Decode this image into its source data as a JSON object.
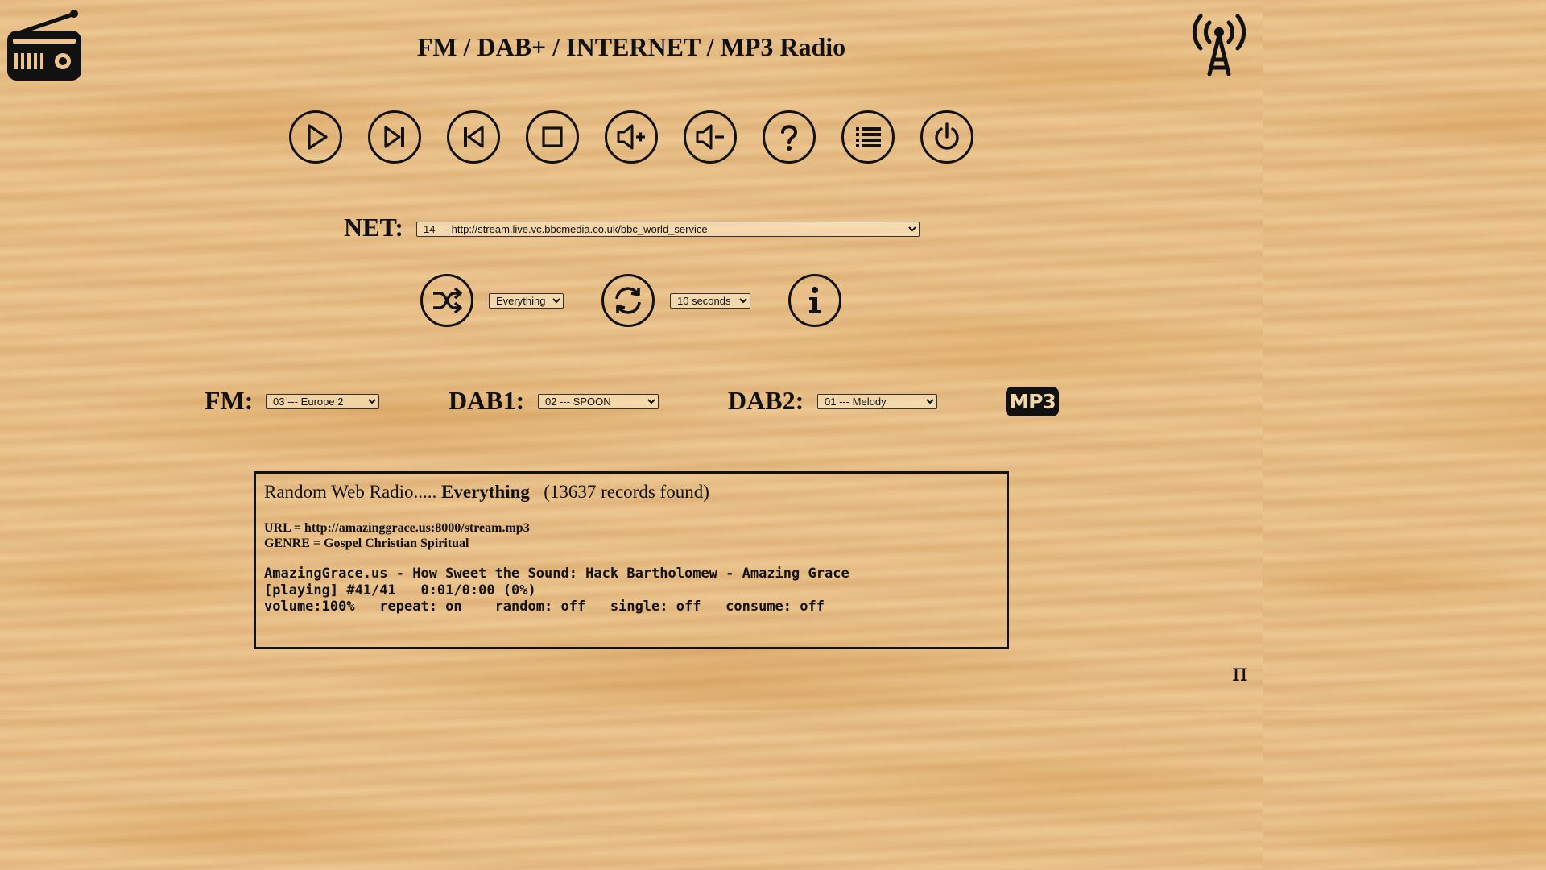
{
  "header": {
    "title": "FM / DAB+ / INTERNET / MP3 Radio",
    "logo_icon": "radio-icon",
    "antenna_icon": "antenna-tower-icon"
  },
  "controls": [
    {
      "name": "play",
      "icon": "play-icon"
    },
    {
      "name": "next",
      "icon": "skip-next-icon"
    },
    {
      "name": "previous",
      "icon": "skip-previous-icon"
    },
    {
      "name": "stop",
      "icon": "stop-icon"
    },
    {
      "name": "volume-up",
      "icon": "volume-up-icon"
    },
    {
      "name": "volume-down",
      "icon": "volume-down-icon"
    },
    {
      "name": "help",
      "icon": "help-icon"
    },
    {
      "name": "playlist",
      "icon": "list-icon"
    },
    {
      "name": "power",
      "icon": "power-icon"
    }
  ],
  "net": {
    "label": "NET:",
    "selected": "14 --- http://stream.live.vc.bbcmedia.co.uk/bbc_world_service"
  },
  "random": {
    "icon": "shuffle-icon",
    "selected": "Everything"
  },
  "refresh": {
    "icon": "refresh-icon",
    "selected": "10 seconds"
  },
  "info": {
    "icon": "info-icon"
  },
  "fm": {
    "label": "FM:",
    "selected": "03 --- Europe 2"
  },
  "dab1": {
    "label": "DAB1:",
    "selected": "02 --- SPOON"
  },
  "dab2": {
    "label": "DAB2:",
    "selected": "01 --- Melody"
  },
  "mp3": {
    "label": "MP3"
  },
  "status": {
    "prefix": "Random Web Radio..... ",
    "mode": "Everything",
    "records": "(13637 records found)",
    "url_line": "URL = http://amazinggrace.us:8000/stream.mp3",
    "genre_line": "GENRE = Gospel Christian Spiritual",
    "track_line": "AmazingGrace.us - How Sweet the Sound: Hack Bartholomew - Amazing Grace",
    "playing_line": "[playing] #41/41   0:01/0:00 (0%)",
    "options_line": "volume:100%   repeat: on    random: off   single: off   consume: off"
  },
  "footer": {
    "pi_symbol": "π"
  },
  "colors": {
    "ink": "#111111",
    "wood": "#ebc48e",
    "mp3_text": "#f3d6a8"
  }
}
